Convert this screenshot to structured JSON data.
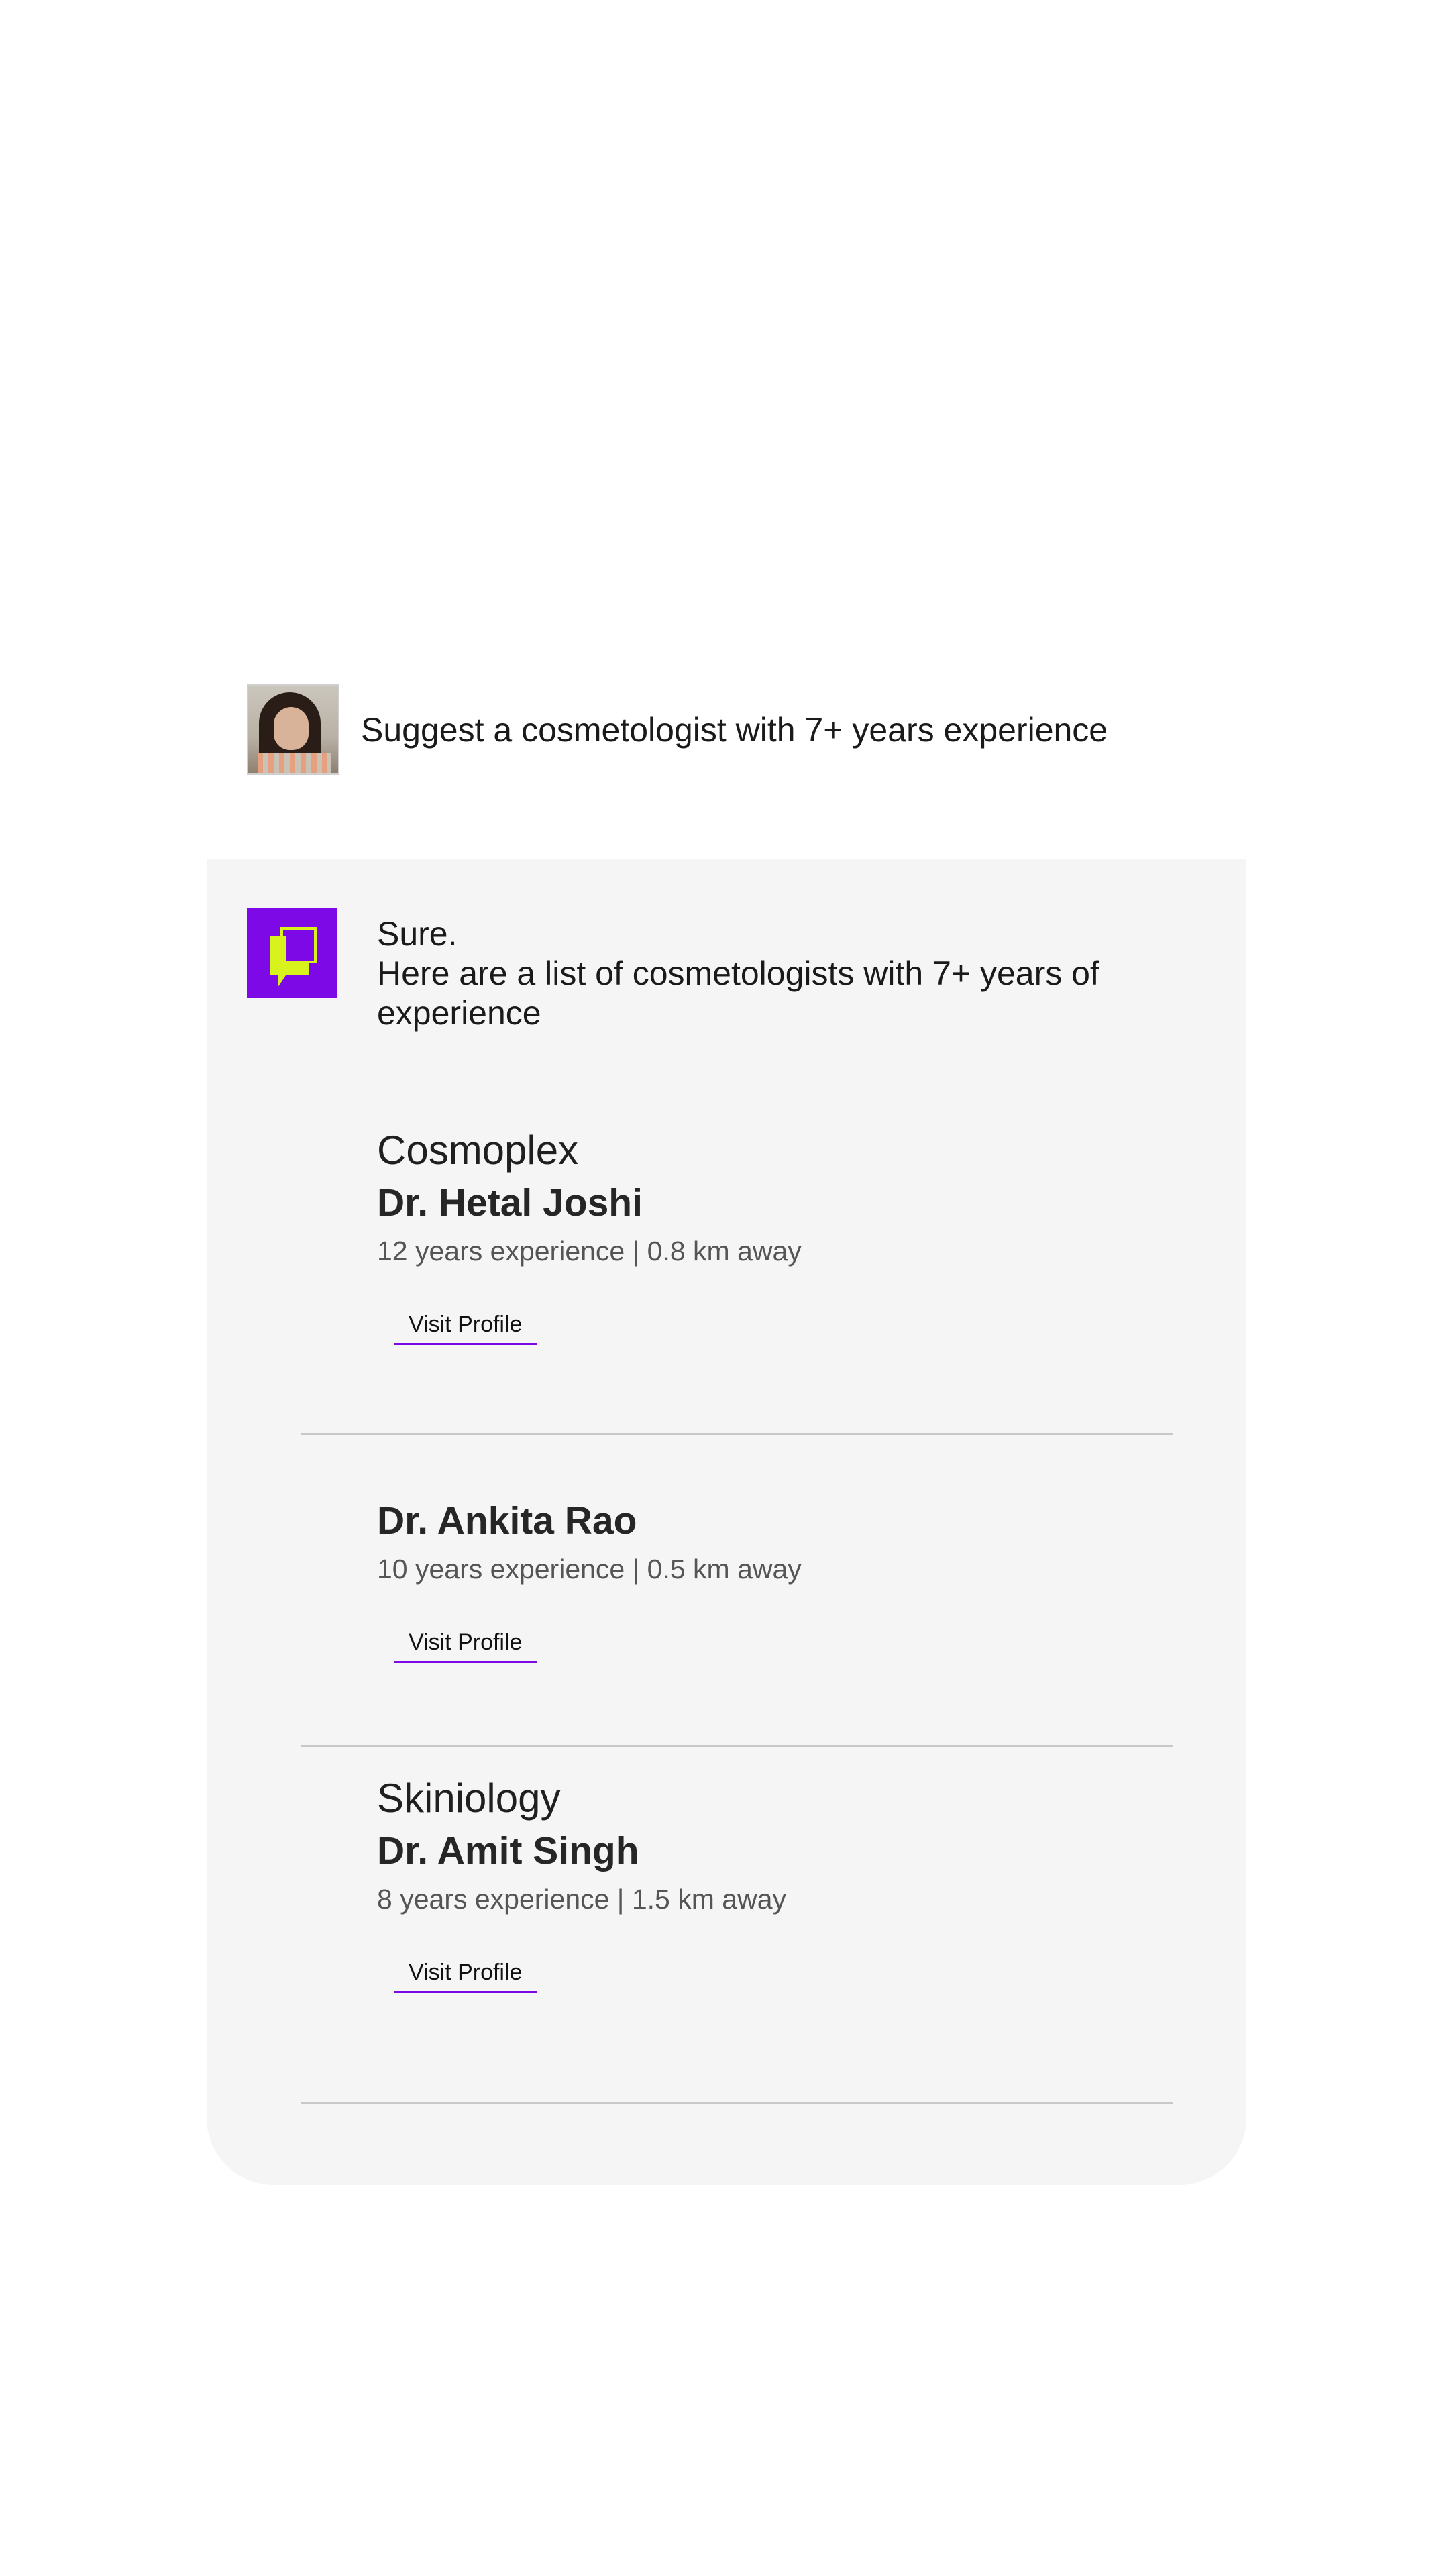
{
  "user_message": {
    "text": "Suggest a cosmetologist with 7+ years experience"
  },
  "bot_reply": {
    "line1": "Sure.",
    "line2": "Here are a list of cosmetologists with 7+ years of experience"
  },
  "results": [
    {
      "clinic": "Cosmoplex",
      "name": "Dr. Hetal Joshi",
      "meta": "12 years experience | 0.8 km away",
      "button": "Visit Profile"
    },
    {
      "clinic": "",
      "name": "Dr. Ankita Rao",
      "meta": "10 years experience | 0.5 km away",
      "button": "Visit Profile"
    },
    {
      "clinic": "Skiniology",
      "name": "Dr. Amit Singh",
      "meta": "8 years experience | 1.5 km away",
      "button": "Visit Profile"
    }
  ],
  "colors": {
    "accent": "#7d0ae6",
    "logo_mark": "#d7f21c",
    "card_bg": "#f5f5f5",
    "divider": "#c8c8c8"
  },
  "icons": {
    "user_avatar": "user-photo-avatar",
    "bot_logo": "chat-bubble-logo-icon"
  }
}
